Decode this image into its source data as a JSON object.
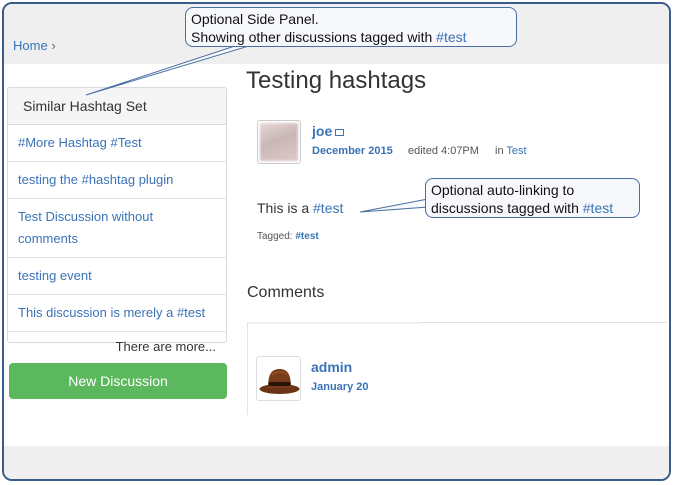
{
  "breadcrumb": {
    "home": "Home",
    "separator": "›"
  },
  "side_panel": {
    "title": "Similar Hashtag Set",
    "items": [
      {
        "label": "#More Hashtag #Test"
      },
      {
        "label": "testing the #hashtag plugin"
      },
      {
        "label": "Test Discussion without comments"
      },
      {
        "label": "testing event"
      },
      {
        "label": "This discussion is merely a #test"
      }
    ],
    "more": "There are more..."
  },
  "new_discussion_label": "New Discussion",
  "discussion": {
    "title": "Testing hashtags",
    "author": "joe",
    "date": "December 2015",
    "edited": "edited 4:07PM",
    "in_prefix": "in",
    "category": "Test",
    "body_prefix": "This is a",
    "body_tag": "#test",
    "tagged_label": "Tagged:",
    "tagged_tag": "#test"
  },
  "comments": {
    "heading": "Comments",
    "items": [
      {
        "author": "admin",
        "date": "January 20"
      }
    ]
  },
  "callouts": {
    "side_panel_line1": "Optional Side Panel.",
    "side_panel_line2": "Showing other discussions tagged with",
    "side_panel_tag": "#test",
    "autolink_line1": "Optional auto-linking to",
    "autolink_line2": "discussions tagged with",
    "autolink_tag": "#test"
  },
  "icons": {
    "mail": "envelope-icon",
    "comment_avatar": "hat-icon",
    "author_avatar": "blurred-avatar"
  },
  "colors": {
    "link": "#3a73b6",
    "button": "#5cb85c",
    "callout_border": "#4a6ea3",
    "frame_border": "#3b5b8c"
  }
}
